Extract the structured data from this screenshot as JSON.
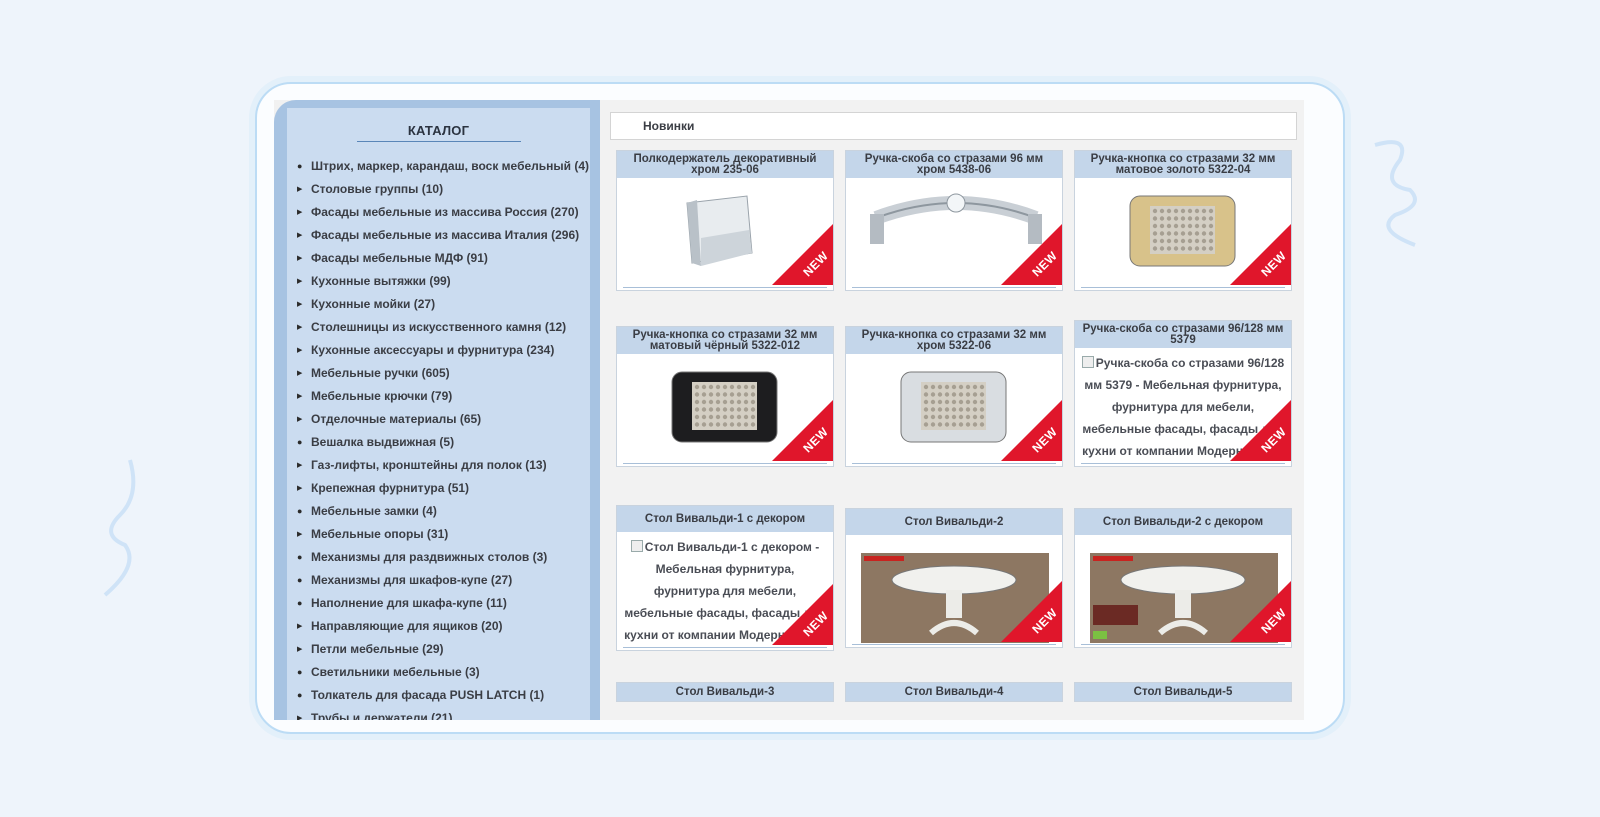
{
  "catalog": {
    "title": "КАТАЛОГ",
    "items": [
      {
        "label": "Штрих, маркер, карандаш, воск мебельный (4)",
        "marker": "dot"
      },
      {
        "label": "Столовые группы (10)",
        "marker": "arrow"
      },
      {
        "label": "Фасады мебельные из массива Россия (270)",
        "marker": "arrow"
      },
      {
        "label": "Фасады мебельные из массива Италия (296)",
        "marker": "arrow"
      },
      {
        "label": "Фасады мебельные МДФ (91)",
        "marker": "arrow"
      },
      {
        "label": "Кухонные вытяжки (99)",
        "marker": "arrow"
      },
      {
        "label": "Кухонные мойки (27)",
        "marker": "arrow"
      },
      {
        "label": "Столешницы из искусственного камня (12)",
        "marker": "arrow"
      },
      {
        "label": "Кухонные аксессуары и фурнитура (234)",
        "marker": "arrow"
      },
      {
        "label": "Мебельные ручки (605)",
        "marker": "arrow"
      },
      {
        "label": "Мебельные крючки (79)",
        "marker": "arrow"
      },
      {
        "label": "Отделочные материалы (65)",
        "marker": "arrow"
      },
      {
        "label": "Вешалка выдвижная (5)",
        "marker": "dot"
      },
      {
        "label": "Газ-лифты, кронштейны для полок (13)",
        "marker": "arrow"
      },
      {
        "label": "Крепежная фурнитура (51)",
        "marker": "arrow"
      },
      {
        "label": "Мебельные замки (4)",
        "marker": "dot"
      },
      {
        "label": "Мебельные опоры (31)",
        "marker": "arrow"
      },
      {
        "label": "Механизмы для раздвижных столов (3)",
        "marker": "dot"
      },
      {
        "label": "Механизмы для шкафов-купе (27)",
        "marker": "dot"
      },
      {
        "label": "Наполнение для шкафа-купе (11)",
        "marker": "dot"
      },
      {
        "label": "Направляющие для ящиков (20)",
        "marker": "arrow"
      },
      {
        "label": "Петли мебельные (29)",
        "marker": "arrow"
      },
      {
        "label": "Светильники мебельные (3)",
        "marker": "dot"
      },
      {
        "label": "Толкатель для фасада PUSH LATCH (1)",
        "marker": "dot"
      },
      {
        "label": "Трубы и держатели (21)",
        "marker": "arrow"
      }
    ]
  },
  "breadcrumb": "Новинки",
  "badge": "NEW",
  "products": [
    {
      "title": "Полкодержатель декоративный хром 235-06",
      "image": "shelf-holder-icon"
    },
    {
      "title": "Ручка-скоба со стразами 96 мм хром 5438-06",
      "image": "handle-bar-icon"
    },
    {
      "title": "Ручка-кнопка со стразами 32 мм матовое золото 5322-04",
      "image": "gold-knob-icon"
    },
    {
      "title": "Ручка-кнопка со стразами 32 мм матовый чёрный 5322-012",
      "image": "black-knob-icon"
    },
    {
      "title": "Ручка-кнопка со стразами 32 мм хром 5322-06",
      "image": "chrome-knob-icon"
    },
    {
      "title": "Ручка-скоба со стразами 96/128 мм 5379",
      "alt": "Ручка-скоба со стразами 96/128 мм 5379 - Мебельная фурнитура, фурнитура для мебели, мебельные фасады, фасады для кухни от компании Модерн-Стиль А"
    },
    {
      "title": "Стол Вивальди-1 с декором",
      "alt": "Стол Вивальди-1 с декором - Мебельная фурнитура, фурнитура для мебели, мебельные фасады, фасады для кухни от компании Модерн-Стиль А"
    },
    {
      "title": "Стол Вивальди-2",
      "image": "table-icon"
    },
    {
      "title": "Стол Вивальди-2 с декором",
      "image": "table-decor-icon"
    },
    {
      "title": "Стол Вивальди-3"
    },
    {
      "title": "Стол Вивальди-4"
    },
    {
      "title": "Стол Вивальди-5"
    }
  ]
}
